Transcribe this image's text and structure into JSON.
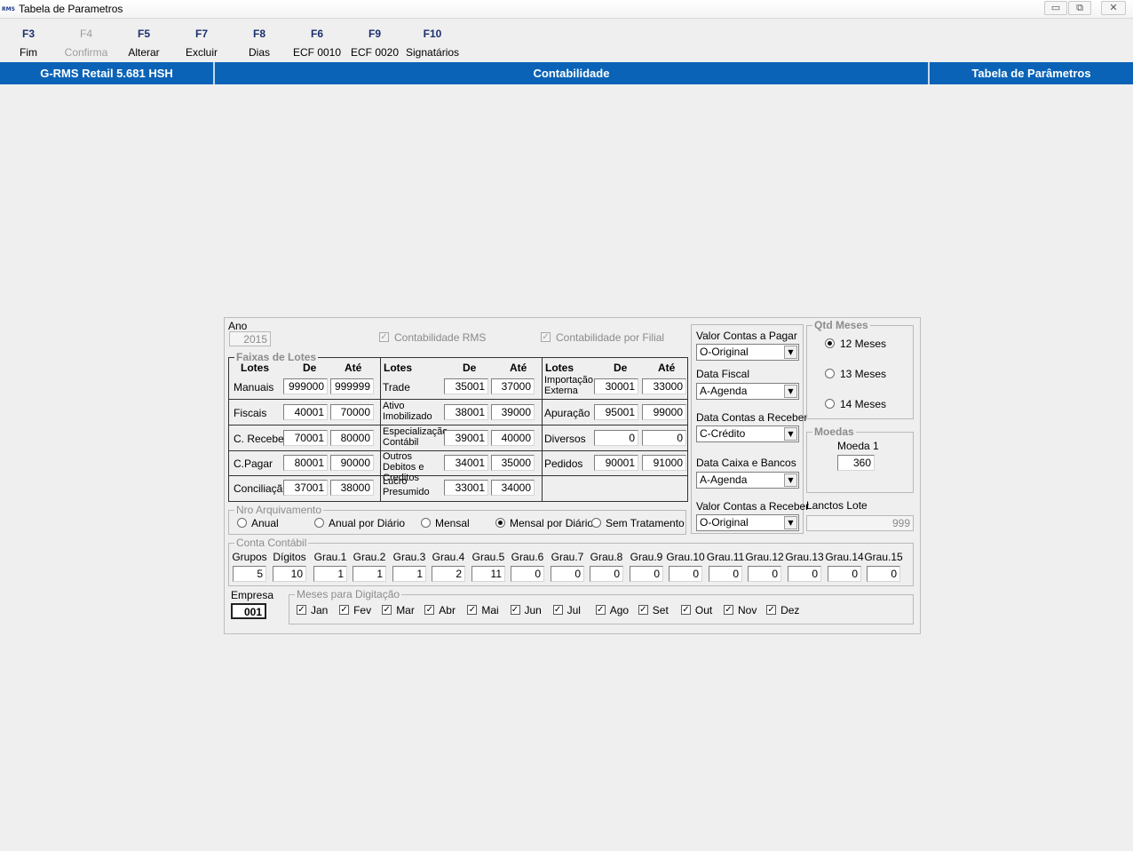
{
  "window": {
    "logo": "RMS",
    "title": "Tabela de Parametros",
    "min": "▭",
    "restore": "⧉",
    "close": "✕"
  },
  "toolbar": [
    {
      "key": "F3",
      "label": "Fim"
    },
    {
      "key": "F4",
      "label": "Confirma",
      "disabled": true
    },
    {
      "key": "F5",
      "label": "Alterar"
    },
    {
      "key": "F7",
      "label": "Excluir"
    },
    {
      "key": "F8",
      "label": "Dias"
    },
    {
      "key": "F6",
      "label": "ECF 0010"
    },
    {
      "key": "F9",
      "label": "ECF 0020"
    },
    {
      "key": "F10",
      "label": "Signatários"
    }
  ],
  "header": {
    "left": "G-RMS Retail 5.681 HSH",
    "center": "Contabilidade",
    "right": "Tabela de Parâmetros"
  },
  "form": {
    "ano_label": "Ano",
    "ano": "2015",
    "contab_rms": "Contabilidade RMS",
    "contab_filial": "Contabilidade por Filial",
    "faixas_title": "Faixas de Lotes",
    "col_lotes": "Lotes",
    "col_de": "De",
    "col_ate": "Até",
    "rows": [
      [
        "Manuais",
        "999000",
        "999999",
        "Trade",
        "35001",
        "37000",
        "Importação Externa",
        "30001",
        "33000"
      ],
      [
        "Fiscais",
        "40001",
        "70000",
        "Ativo Imobilizado",
        "38001",
        "39000",
        "Apuração",
        "95001",
        "99000"
      ],
      [
        "C. Receber",
        "70001",
        "80000",
        "Especialização Contábil",
        "39001",
        "40000",
        "Diversos",
        "0",
        "0"
      ],
      [
        "C.Pagar",
        "80001",
        "90000",
        "Outros Debitos e Creditos",
        "34001",
        "35000",
        "Pedidos",
        "90001",
        "91000"
      ],
      [
        "Conciliação",
        "37001",
        "38000",
        "Lucro Presumido",
        "33001",
        "34000",
        "",
        "",
        ""
      ]
    ],
    "nro_title": "Nro Arquivamento",
    "nro_options": [
      "Anual",
      "Anual por Diário",
      "Mensal",
      "Mensal por Diário",
      "Sem Tratamento"
    ],
    "nro_selected": "Mensal por Diário",
    "valor_pagar_label": "Valor Contas a Pagar",
    "valor_pagar": "O-Original",
    "data_fiscal_label": "Data Fiscal",
    "data_fiscal": "A-Agenda",
    "data_receber_label": "Data Contas a Receber",
    "data_receber": "C-Crédito",
    "data_caixa_label": "Data Caixa e Bancos",
    "data_caixa": "A-Agenda",
    "valor_receber_label": "Valor Contas a Receber",
    "valor_receber": "O-Original",
    "qtd_title": "Qtd Meses",
    "qtd_options": [
      "12 Meses",
      "13 Meses",
      "14 Meses"
    ],
    "qtd_selected": "12 Meses",
    "moedas_title": "Moedas",
    "moeda1_label": "Moeda 1",
    "moeda1": "360",
    "lanctos_label": "Lanctos Lote",
    "lanctos": "999",
    "conta_title": "Conta Contábil",
    "conta_headers": [
      "Grupos",
      "Dígitos",
      "Grau.1",
      "Grau.2",
      "Grau.3",
      "Grau.4",
      "Grau.5",
      "Grau.6",
      "Grau.7",
      "Grau.8",
      "Grau.9",
      "Grau.10",
      "Grau.11",
      "Grau.12",
      "Grau.13",
      "Grau.14",
      "Grau.15"
    ],
    "conta_values": [
      "5",
      "10",
      "1",
      "1",
      "1",
      "2",
      "11",
      "0",
      "0",
      "0",
      "0",
      "0",
      "0",
      "0",
      "0",
      "0",
      "0"
    ],
    "empresa_label": "Empresa",
    "empresa": "001",
    "meses_title": "Meses para Digitação",
    "meses": [
      "Jan",
      "Fev",
      "Mar",
      "Abr",
      "Mai",
      "Jun",
      "Jul",
      "Ago",
      "Set",
      "Out",
      "Nov",
      "Dez"
    ],
    "check_mark": "✓"
  }
}
